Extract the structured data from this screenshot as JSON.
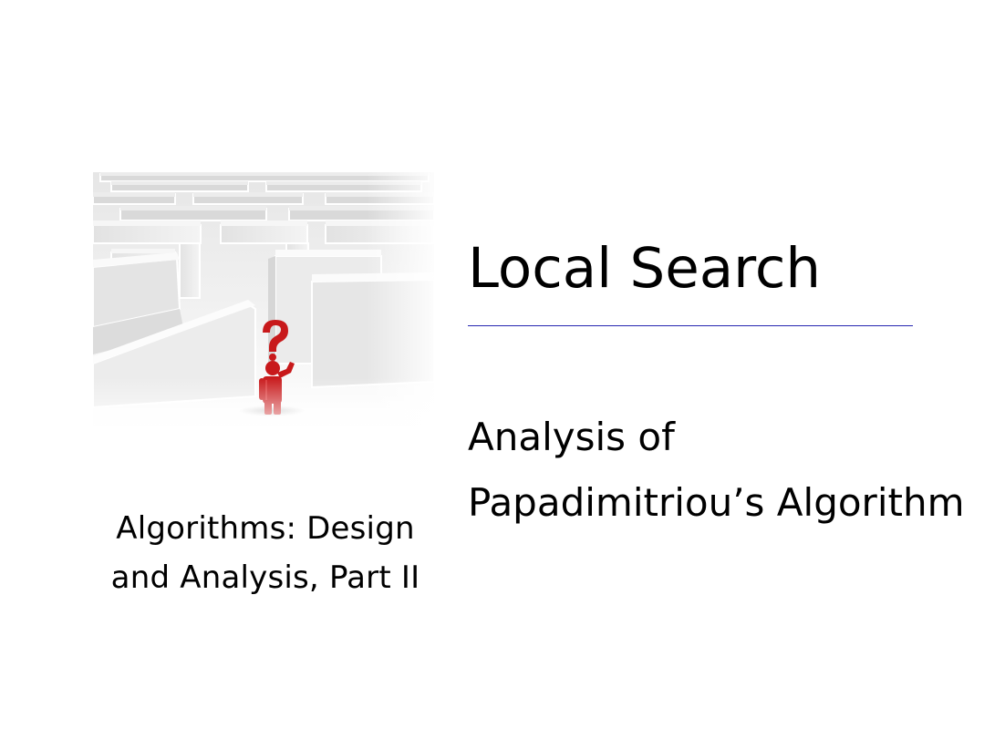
{
  "slide": {
    "image": {
      "icon": "maze-question-person-icon",
      "figure_color": "#c8191b"
    },
    "course_title": {
      "line1": "Algorithms: Design",
      "line2": "and Analysis, Part II"
    },
    "lecture_title": "Local Search",
    "rule_color": "#2626b0",
    "lecture_subtitle": {
      "line1": "Analysis of",
      "line2": "Papadimitriou’s Algorithm"
    }
  }
}
